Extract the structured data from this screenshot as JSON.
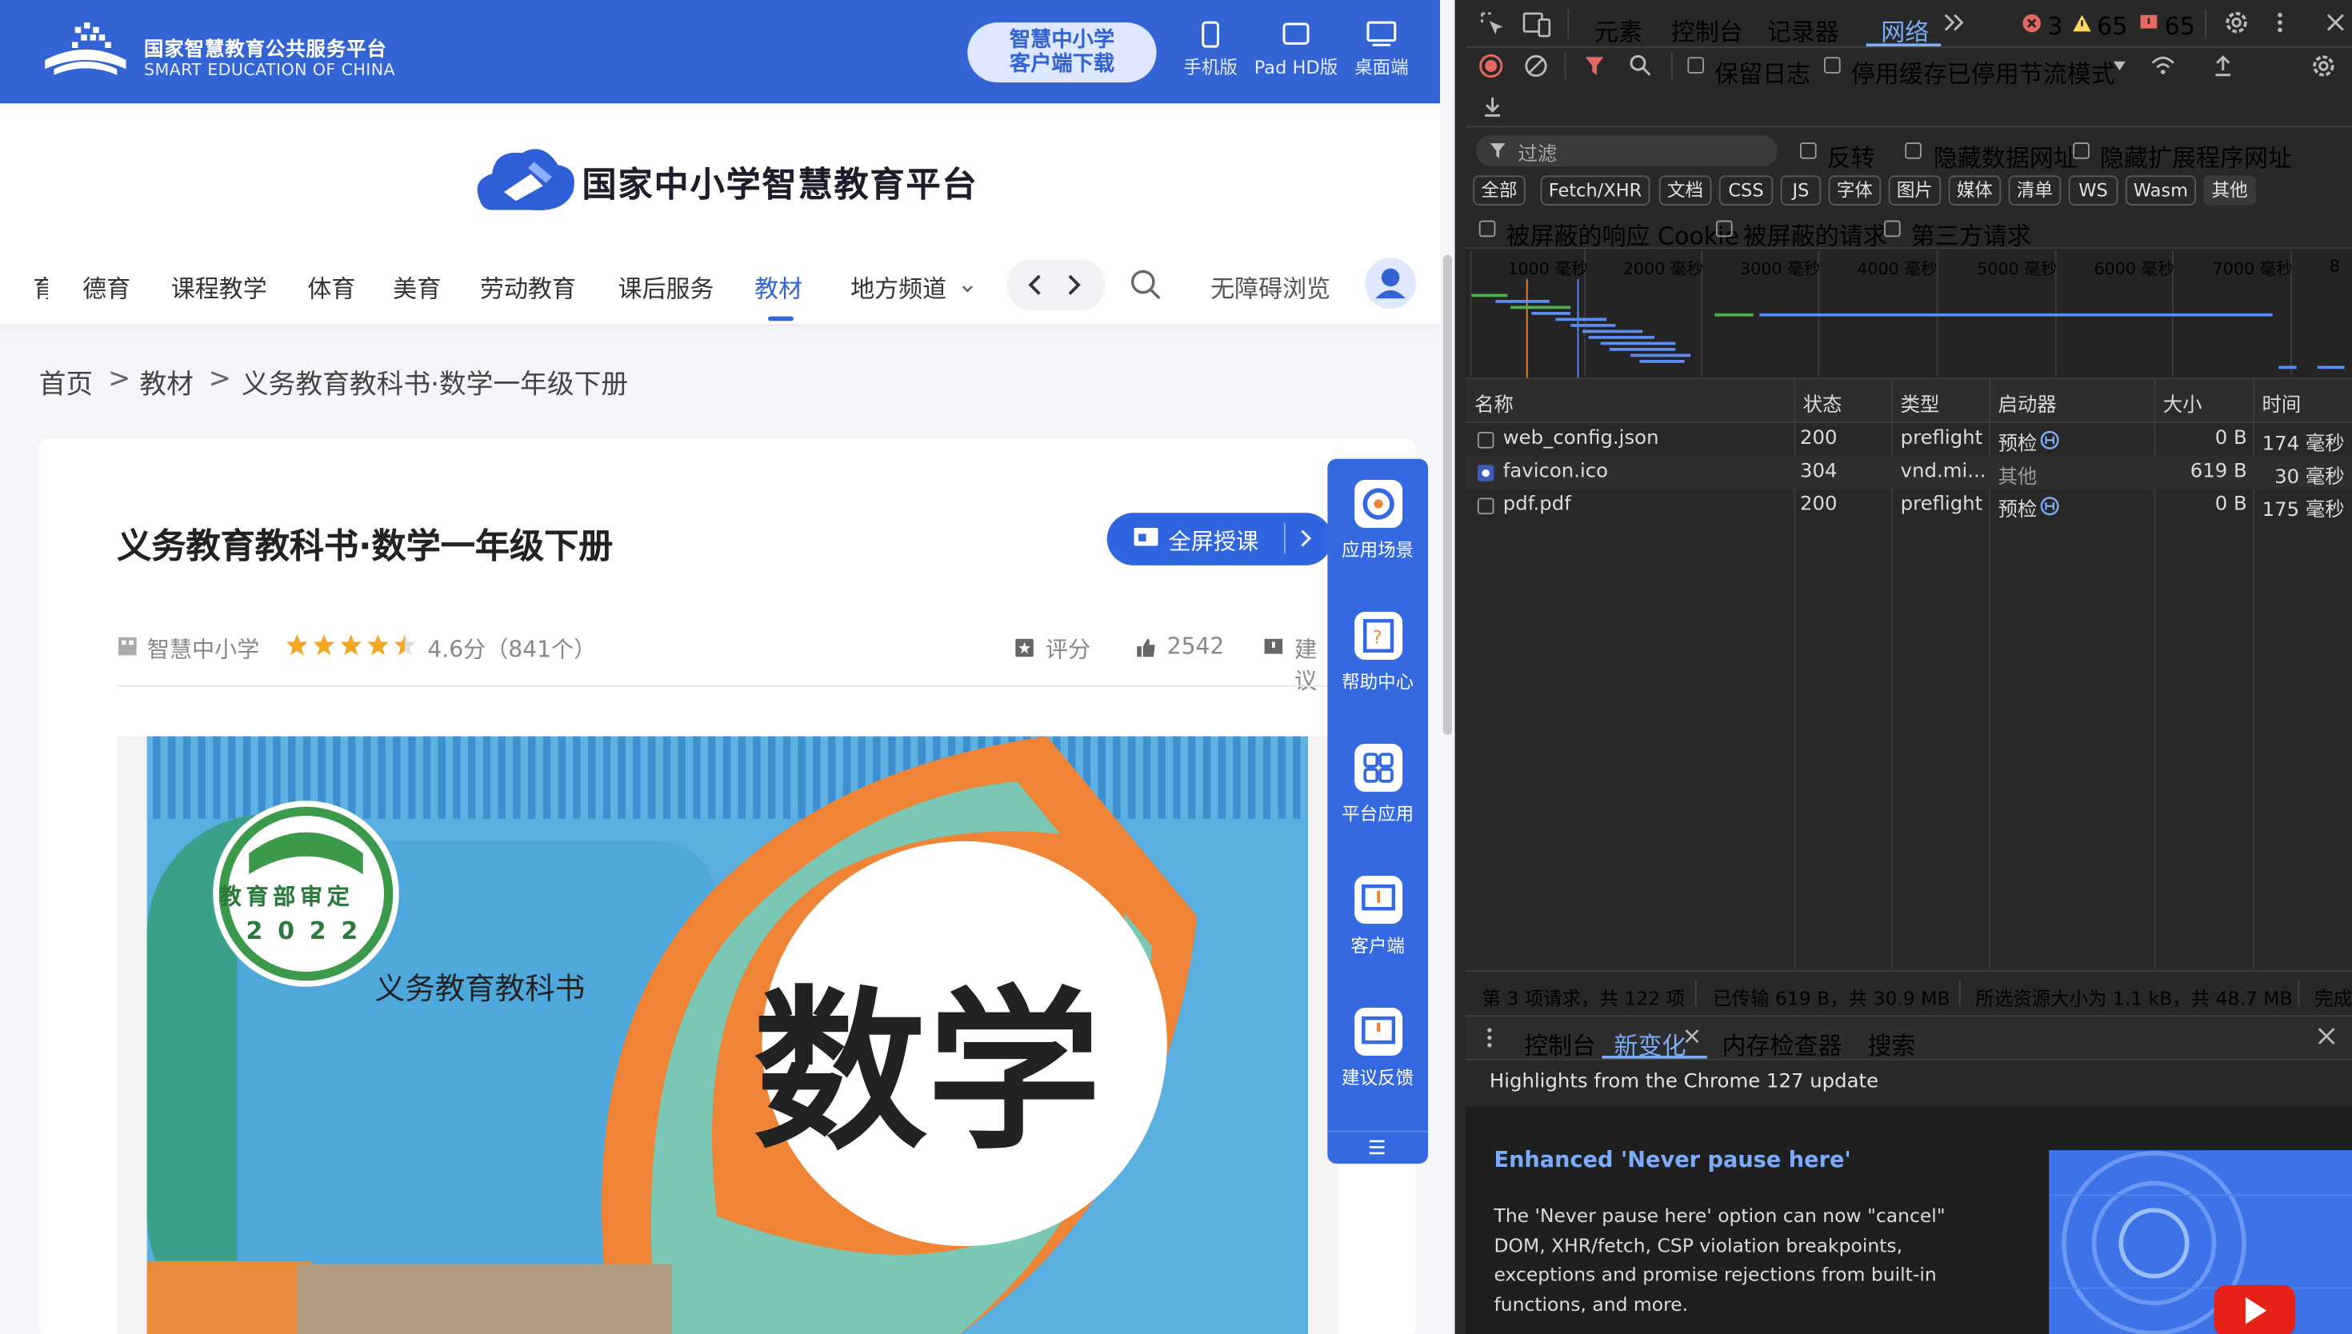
{
  "site": {
    "name_cn": "国家智慧教育公共服务平台",
    "name_en": "SMART EDUCATION OF CHINA",
    "download_label": "智慧中小学\n客户端下载",
    "devices": [
      "手机版",
      "Pad HD版",
      "桌面端"
    ],
    "brand_title": "国家中小学智慧教育平台"
  },
  "nav": {
    "items": [
      "育",
      "德育",
      "课程教学",
      "体育",
      "美育",
      "劳动教育",
      "课后服务",
      "教材",
      "地方频道"
    ],
    "active": "教材",
    "accessibility": "无障碍浏览"
  },
  "breadcrumb": [
    "首页",
    ">",
    "教材",
    ">",
    "义务教育教科书·数学一年级下册"
  ],
  "book": {
    "title": "义务教育教科书·数学一年级下册",
    "fullscreen_label": "全屏授课",
    "publisher": "智慧中小学",
    "rating": "4.6分（841个）",
    "rating_value": 4.6,
    "rate_label": "评分",
    "likes": "2542",
    "suggest_label": "建议",
    "cover_seal_top": "教育部审定",
    "cover_seal_year": "2022",
    "cover_series": "义务教育教科书",
    "cover_subject": "数学"
  },
  "float_menu": [
    "应用场景",
    "帮助中心",
    "平台应用",
    "客户端",
    "建议反馈"
  ],
  "devtools": {
    "tabs": [
      "元素",
      "控制台",
      "记录器",
      "网络"
    ],
    "active_tab": "网络",
    "errors": "3",
    "warnings": "65",
    "issues": "65",
    "toolbar": {
      "preserve_log": "保留日志",
      "disable_cache": "停用缓存",
      "throttle": "已停用节流模式"
    },
    "filter": {
      "placeholder": "过滤",
      "invert": "反转",
      "hide_data": "隐藏数据网址",
      "hide_ext": "隐藏扩展程序网址",
      "types": [
        "全部",
        "Fetch/XHR",
        "文档",
        "CSS",
        "JS",
        "字体",
        "图片",
        "媒体",
        "清单",
        "WS",
        "Wasm",
        "其他"
      ],
      "active_type": "其他",
      "blocked_cookies": "被屏蔽的响应 Cookie",
      "blocked_requests": "被屏蔽的请求",
      "third_party": "第三方请求"
    },
    "timeline": [
      "1000 毫秒",
      "2000 毫秒",
      "3000 毫秒",
      "4000 毫秒",
      "5000 毫秒",
      "6000 毫秒",
      "7000 毫秒",
      "8"
    ],
    "columns": [
      "名称",
      "状态",
      "类型",
      "启动器",
      "大小",
      "时间"
    ],
    "rows": [
      {
        "name": "web_config.json",
        "status": "200",
        "type": "preflight",
        "initiator": "预检",
        "size": "0 B",
        "time": "174 毫秒"
      },
      {
        "name": "favicon.ico",
        "status": "304",
        "type": "vnd.mi...",
        "initiator": "其他",
        "size": "619 B",
        "time": "30 毫秒"
      },
      {
        "name": "pdf.pdf",
        "status": "200",
        "type": "preflight",
        "initiator": "预检",
        "size": "0 B",
        "time": "175 毫秒"
      }
    ],
    "status_bar": {
      "requests": "第 3 项请求，共 122 项",
      "transferred": "已传输 619 B，共 30.9 MB",
      "resources": "所选资源大小为 1.1 kB，共 48.7 MB",
      "finish": "完成"
    },
    "drawer_tabs": [
      "控制台",
      "新变化",
      "内存检查器",
      "搜索"
    ],
    "drawer_active": "新变化",
    "whats_new": {
      "header": "Highlights from the Chrome 127 update",
      "title": "Enhanced 'Never pause here'",
      "body": "The 'Never pause here' option can now \"cancel\" DOM, XHR/fetch, CSP violation breakpoints, exceptions and promise rejections from built-in functions, and more."
    }
  },
  "colors": {
    "brand_blue": "#3464d4",
    "devtools_bg": "#282828",
    "link_blue": "#7cacf8"
  }
}
